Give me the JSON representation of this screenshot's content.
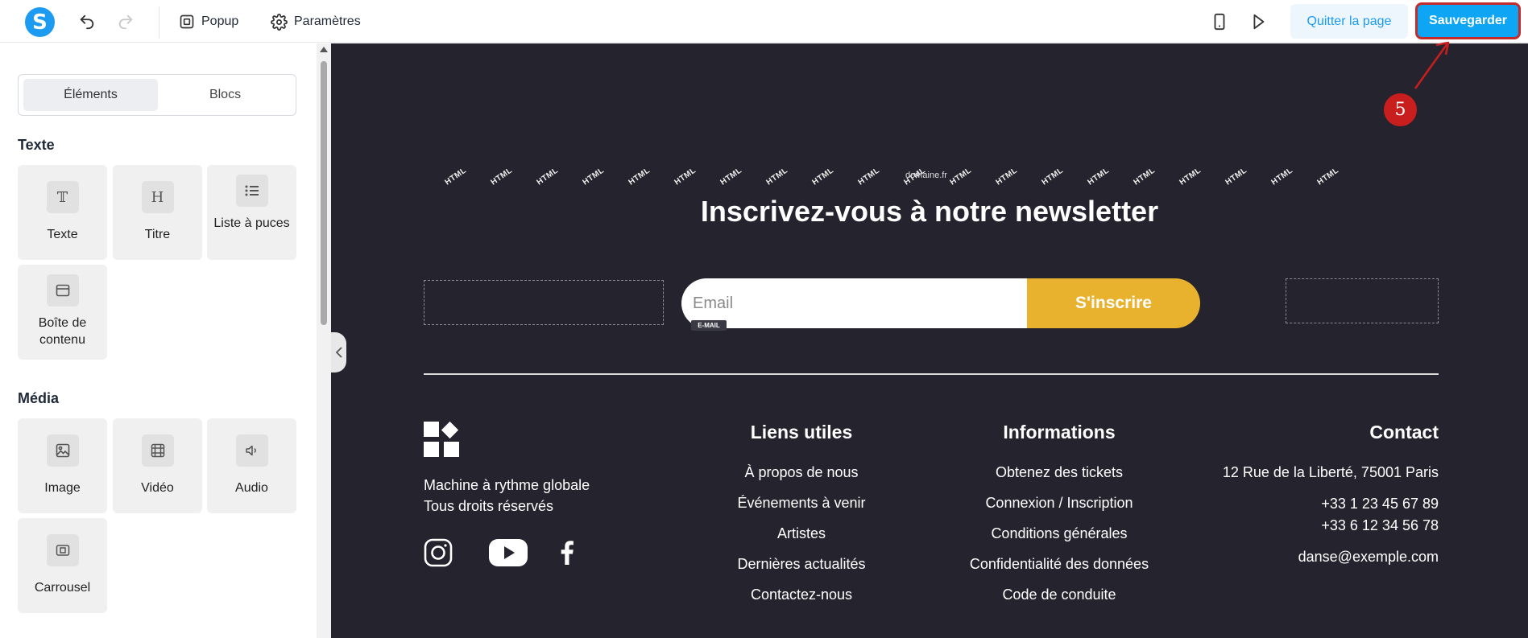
{
  "toolbar": {
    "logo_letter": "S",
    "popup_label": "Popup",
    "settings_label": "Paramètres",
    "quit_label": "Quitter la page",
    "save_label": "Sauvegarder",
    "accent_color": "#1d9bf0",
    "save_color": "#0ea5f4"
  },
  "sidebar": {
    "tabs": [
      {
        "label": "Éléments",
        "active": true
      },
      {
        "label": "Blocs",
        "active": false
      }
    ],
    "sections": [
      {
        "title": "Texte",
        "items": [
          {
            "label": "Texte",
            "icon": "text-icon"
          },
          {
            "label": "Titre",
            "icon": "heading-icon"
          },
          {
            "label": "Liste à puces",
            "icon": "list-icon"
          },
          {
            "label": "Boîte de contenu",
            "icon": "content-box-icon"
          }
        ]
      },
      {
        "title": "Média",
        "items": [
          {
            "label": "Image",
            "icon": "image-icon"
          },
          {
            "label": "Vidéo",
            "icon": "video-icon"
          },
          {
            "label": "Audio",
            "icon": "audio-icon"
          },
          {
            "label": "Carrousel",
            "icon": "carousel-icon"
          }
        ]
      }
    ]
  },
  "canvas": {
    "background": "#25242e",
    "html_tag": "HTML",
    "domain_mark": "domaine.fr",
    "newsletter_title": "Inscrivez-vous à notre newsletter",
    "email_placeholder": "Email",
    "email_badge": "E-MAIL",
    "subscribe_label": "S'inscrire",
    "subscribe_color": "#e8b22f",
    "tagline_line1": "Machine à rythme globale",
    "tagline_line2": "Tous droits réservés",
    "social_icons": [
      "instagram-icon",
      "youtube-icon",
      "facebook-icon"
    ],
    "columns": {
      "useful": {
        "title": "Liens utiles",
        "links": [
          "À propos de nous",
          "Événements à venir",
          "Artistes",
          "Dernières actualités",
          "Contactez-nous"
        ]
      },
      "info": {
        "title": "Informations",
        "links": [
          "Obtenez des tickets",
          "Connexion / Inscription",
          "Conditions générales",
          "Confidentialité des données",
          "Code de conduite"
        ]
      },
      "contact": {
        "title": "Contact",
        "address": "12 Rue de la Liberté, 75001 Paris",
        "phone1": "+33 1 23 45 67 89",
        "phone2": "+33 6 12 34 56 78",
        "email": "danse@exemple.com"
      }
    }
  },
  "annotation": {
    "step": "5",
    "color": "#c81e1e"
  }
}
